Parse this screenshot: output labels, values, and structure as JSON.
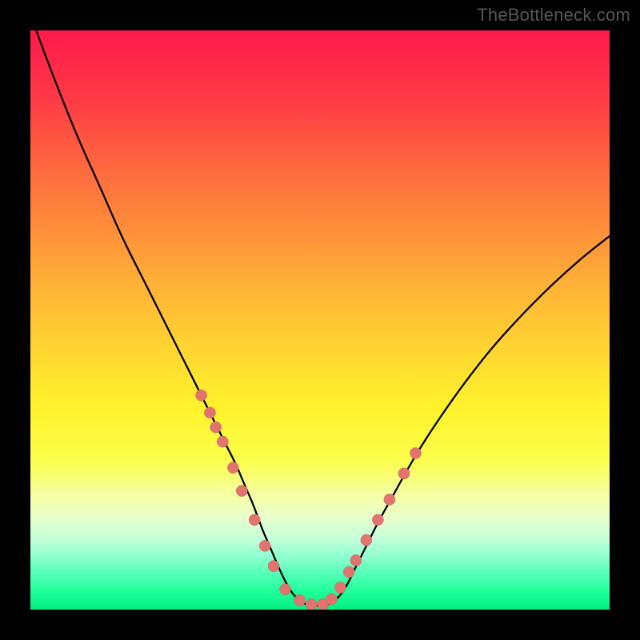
{
  "watermark": "TheBottleneck.com",
  "chart_data": {
    "type": "line",
    "title": "",
    "xlabel": "",
    "ylabel": "",
    "xlim": [
      0,
      100
    ],
    "ylim": [
      0,
      100
    ],
    "grid": false,
    "legend": false,
    "background_gradient": {
      "top": "#ff1a4b",
      "mid": "#fff22b",
      "bottom": "#00f07e"
    },
    "series": [
      {
        "name": "bottleneck-curve",
        "color": "#000000",
        "x": [
          1,
          4,
          8,
          12,
          16,
          20,
          24,
          27,
          29.5,
          31.5,
          33.5,
          35.5,
          37,
          38.5,
          40,
          41.5,
          43,
          44.5,
          46,
          48,
          51,
          53,
          54.5,
          56,
          58,
          60,
          62.5,
          65,
          68,
          72,
          76,
          80,
          85,
          90,
          95,
          100
        ],
        "y": [
          100,
          92,
          82,
          73,
          64,
          56,
          48,
          42,
          37,
          33,
          29,
          25,
          21.5,
          18,
          14,
          10.5,
          7,
          4,
          2,
          0.8,
          0.8,
          2,
          4,
          7,
          11,
          15,
          19.5,
          24,
          29,
          35,
          40.5,
          45.5,
          51,
          56,
          60.5,
          64.5
        ]
      },
      {
        "name": "sample-points",
        "type": "scatter",
        "color": "#e2746f",
        "x": [
          29.5,
          31,
          32,
          33.2,
          35,
          36.5,
          38.7,
          40.5,
          42,
          44,
          46.5,
          48.5,
          50.5,
          52,
          53.5,
          55,
          56.2,
          58,
          60,
          62,
          64.5,
          66.5
        ],
        "y": [
          37,
          34,
          31.5,
          29,
          24.5,
          20.5,
          15.5,
          11,
          7.5,
          3.5,
          1.6,
          0.9,
          0.9,
          1.8,
          3.8,
          6.5,
          8.5,
          12,
          15.5,
          19,
          23.5,
          27
        ]
      }
    ]
  }
}
